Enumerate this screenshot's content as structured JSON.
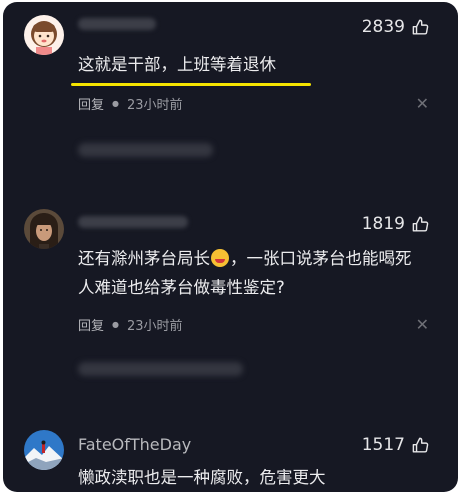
{
  "colors": {
    "background": "#161823",
    "underline": "#f5e400",
    "text": "#ececee",
    "meta": "#9a9ba2"
  },
  "comments": [
    {
      "username": "",
      "likes": "2839",
      "text": "这就是干部，上班等着退休",
      "reply_label": "回复",
      "time": "23小时前",
      "avatar": "cartoon-girl-avatar"
    },
    {
      "username": "",
      "likes": "1819",
      "text_before_emoji": "还有滁州茅台局长",
      "text_after_emoji": "，一张口说茅台也能喝死人难道也给茅台做毒性鉴定?",
      "emoji": "laughing-emoji",
      "reply_label": "回复",
      "time": "23小时前",
      "avatar": "man-portrait-avatar"
    },
    {
      "username": "FateOfTheDay",
      "likes": "1517",
      "text": "懒政渎职也是一种腐败，危害更大",
      "avatar": "mountain-climber-avatar"
    }
  ]
}
